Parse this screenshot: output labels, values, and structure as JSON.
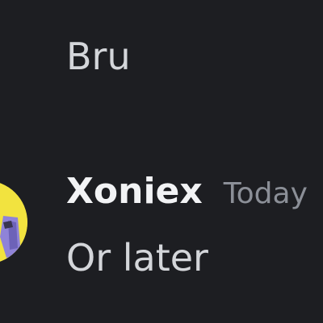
{
  "messages": [
    {
      "continuation": true,
      "content": "Bru"
    },
    {
      "author": "Xoniex",
      "timestamp": "Today",
      "content": "Or later",
      "avatar_icon": "user-avatar-icon",
      "avatar_bg": "#f2e33f"
    }
  ]
}
